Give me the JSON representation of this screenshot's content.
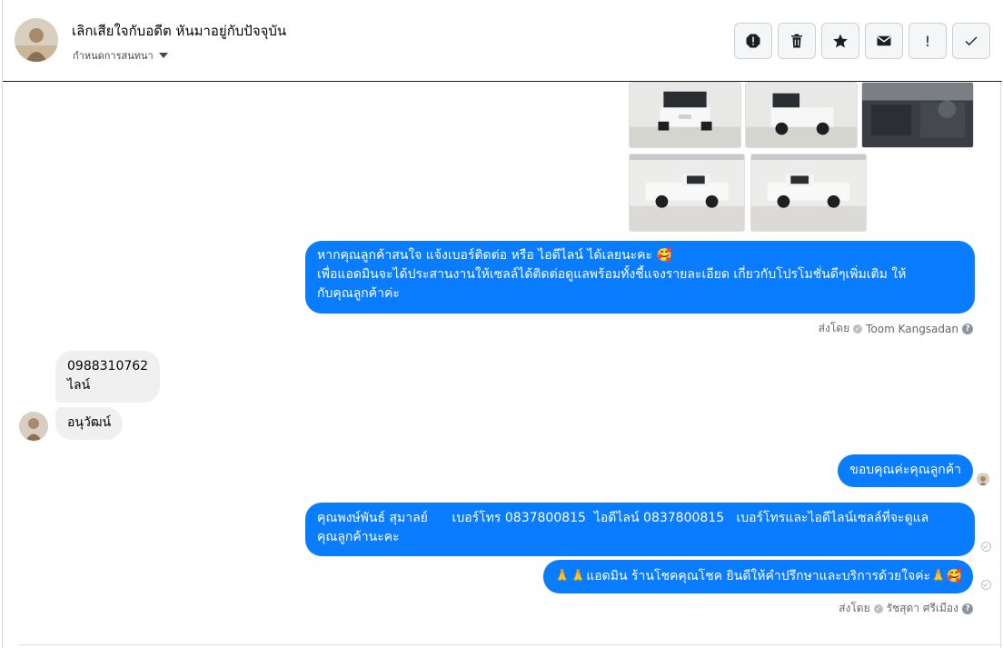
{
  "header": {
    "title": "เลิกเสียใจกับอดีต หันมาอยู่กับปัจจุบัน",
    "subtitle": "กำหนดการสนทนา",
    "actions": [
      {
        "name": "report-icon"
      },
      {
        "name": "trash-icon"
      },
      {
        "name": "star-icon"
      },
      {
        "name": "mail-icon"
      },
      {
        "name": "important-icon",
        "label": "!"
      },
      {
        "name": "checkmark-icon"
      }
    ]
  },
  "messages": {
    "m1": {
      "line1": "หากคุณลูกค้าสนใจ แจ้งเบอร์ติดต่อ หรือ ไอดีไลน์ ได้เลยนะคะ 🥰",
      "line2": "เพื่อแอดมินจะได้ประสานงานให้เซลล์ได้ติดต่อดูแลพร้อมทั้งชี้แจงรายละเอียด เกี่ยวกับโปรโมชั่นดีๆเพิ่มเติม ให้",
      "line3": "กับคุณลูกค้าค่ะ"
    },
    "m1_sent_by": {
      "prefix": "ส่งโดย",
      "name": "Toom Kangsadan"
    },
    "c1": {
      "line1": "0988310762",
      "line2": "ไลน์"
    },
    "c2": "อนุวัฒน์",
    "m2": "ขอบคุณค่ะคุณลูกค้า",
    "m3": {
      "line1": "คุณพงษ์พันธ์ สุมาลย์      เบอร์โทร 0837800815  ไอดีไลน์ 0837800815   เบอร์โทรและไอดีไลน์เซลล์ที่จะดูแล",
      "line2": "คุณลูกค้านะคะ"
    },
    "m4": "🙏🙏แอดมิน ร้านโชคคุณโชค ยินดีให้คำปรึกษาและบริการด้วยใจค่ะ🙏🥰",
    "m4_sent_by": {
      "prefix": "ส่งโดย",
      "name": "รัชสุดา ศรีเมือง"
    }
  },
  "colors": {
    "outgoing": "#0a7cff",
    "incoming": "#f0f0f0"
  }
}
